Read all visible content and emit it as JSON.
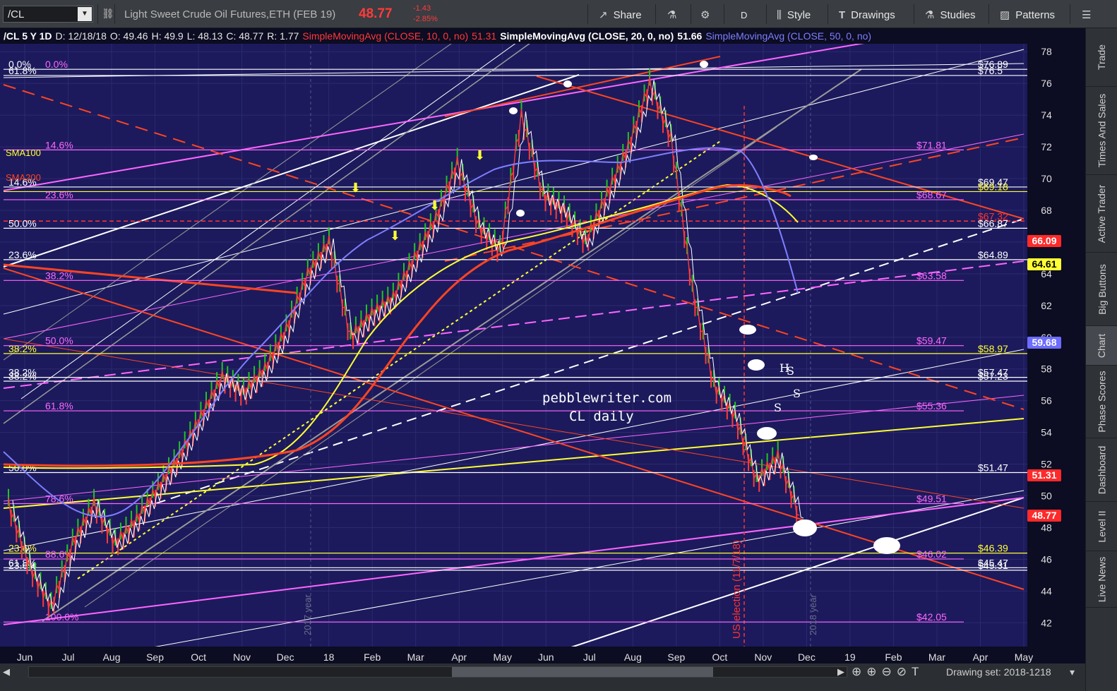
{
  "toolbar": {
    "symbol": "/CL",
    "instrument_title": "Light Sweet Crude Oil Futures,ETH (FEB 19)",
    "price": "48.77",
    "change": "-1.43",
    "change_pct": "-2.85%",
    "share_label": "Share",
    "aggregation_label": "D",
    "style_label": "Style",
    "drawings_label": "Drawings",
    "studies_label": "Studies",
    "patterns_label": "Patterns"
  },
  "chart_header": {
    "symbol_period": "/CL 5 Y 1D",
    "date": "D: 12/18/18",
    "open": "O: 49.46",
    "high": "H: 49.9",
    "low": "L: 48.13",
    "close": "C: 48.77",
    "range": "R: 1.77",
    "sma10_label": "SimpleMovingAvg (CLOSE, 10, 0, no)",
    "sma10_value": "51.31",
    "sma20_label": "SimpleMovingAvg (CLOSE, 20, 0, no)",
    "sma20_value": "51.66",
    "sma50_label": "SimpleMovingAvg (CLOSE, 50, 0, no)"
  },
  "right_tabs": [
    "Trade",
    "Times And Sales",
    "Active Trader",
    "Big Buttons",
    "Chart",
    "Phase Scores",
    "Dashboard",
    "Level II",
    "Live News"
  ],
  "active_tab": "Chart",
  "bottom_bar": {
    "drawing_set": "Drawing set: 2018-1218"
  },
  "watermark": {
    "line1": "pebblewriter.com",
    "line2": "CL daily"
  },
  "annotations": {
    "election": "US election (11/7/18)",
    "year_2017": "2017 year",
    "year_2018": "2018 year",
    "sma100": "SMA100",
    "sma200": "SMA200",
    "hs_h": "H",
    "hs_s": "S"
  },
  "chart_data": {
    "type": "candlestick",
    "symbol": "/CL",
    "x_labels": [
      "Jun",
      "Jul",
      "Aug",
      "Sep",
      "Oct",
      "Nov",
      "Dec",
      "18",
      "Feb",
      "Mar",
      "Apr",
      "May",
      "Jun",
      "Jul",
      "Aug",
      "Sep",
      "Oct",
      "Nov",
      "Dec",
      "19",
      "Feb",
      "Mar",
      "Apr",
      "May"
    ],
    "y_ticks": [
      42,
      44,
      46,
      48,
      50,
      52,
      54,
      56,
      58,
      60,
      62,
      64,
      66,
      68,
      70,
      72,
      74,
      76,
      78
    ],
    "ylim": [
      40.5,
      78.5
    ],
    "close_path": [
      [
        "Jun",
        49.5
      ],
      [
        "Jul",
        45.5
      ],
      [
        "Jul",
        43.0
      ],
      [
        "Aug",
        47.0
      ],
      [
        "Aug",
        49.5
      ],
      [
        "Sep",
        47.0
      ],
      [
        "Sep",
        48.5
      ],
      [
        "Oct",
        50.5
      ],
      [
        "Oct",
        52.5
      ],
      [
        "Nov",
        55.0
      ],
      [
        "Nov",
        57.5
      ],
      [
        "Dec",
        56.5
      ],
      [
        "Dec",
        58.0
      ],
      [
        "18",
        60.5
      ],
      [
        "18",
        64.0
      ],
      [
        "Feb",
        66.0
      ],
      [
        "Feb",
        60.0
      ],
      [
        "Mar",
        61.5
      ],
      [
        "Mar",
        62.5
      ],
      [
        "Apr",
        65.0
      ],
      [
        "Apr",
        67.5
      ],
      [
        "May",
        71.0
      ],
      [
        "May",
        67.0
      ],
      [
        "Jun",
        65.5
      ],
      [
        "Jul",
        74.0
      ],
      [
        "Jul",
        69.0
      ],
      [
        "Aug",
        68.0
      ],
      [
        "Aug",
        66.0
      ],
      [
        "Sep",
        69.0
      ],
      [
        "Sep",
        72.0
      ],
      [
        "Oct",
        76.0
      ],
      [
        "Oct",
        72.5
      ],
      [
        "Nov",
        63.0
      ],
      [
        "Nov",
        57.0
      ],
      [
        "Nov",
        55.0
      ],
      [
        "Dec",
        51.0
      ],
      [
        "Dec",
        52.5
      ],
      [
        "Dec",
        48.77
      ]
    ],
    "price_levels": [
      {
        "label": "76.89",
        "value": 76.89,
        "color": "#ffffff"
      },
      {
        "label": "76.5",
        "value": 76.5,
        "color": "#ffffff"
      },
      {
        "label": "71.81",
        "value": 71.81,
        "color": "#ff66ff"
      },
      {
        "label": "69.47",
        "value": 69.47,
        "color": "#ffffff"
      },
      {
        "label": "69.18",
        "value": 69.18,
        "color": "#ffff33"
      },
      {
        "label": "68.67",
        "value": 68.67,
        "color": "#ff66ff"
      },
      {
        "label": "67.32",
        "value": 67.32,
        "color": "#ff3333"
      },
      {
        "label": "66.87",
        "value": 66.87,
        "color": "#ffffff"
      },
      {
        "label": "64.89",
        "value": 64.89,
        "color": "#ffffff"
      },
      {
        "label": "63.58",
        "value": 63.58,
        "color": "#ff66ff"
      },
      {
        "label": "59.47",
        "value": 59.47,
        "color": "#ff66ff"
      },
      {
        "label": "58.97",
        "value": 58.97,
        "color": "#ffff33"
      },
      {
        "label": "57.47",
        "value": 57.47,
        "color": "#ffffff"
      },
      {
        "label": "57.23",
        "value": 57.23,
        "color": "#ffffff"
      },
      {
        "label": "55.36",
        "value": 55.36,
        "color": "#ff66ff"
      },
      {
        "label": "51.47",
        "value": 51.47,
        "color": "#ffffff"
      },
      {
        "label": "49.51",
        "value": 49.51,
        "color": "#ff66ff"
      },
      {
        "label": "46.39",
        "value": 46.39,
        "color": "#ffff33"
      },
      {
        "label": "46.02",
        "value": 46.02,
        "color": "#ff66ff"
      },
      {
        "label": "45.47",
        "value": 45.47,
        "color": "#ffffff"
      },
      {
        "label": "45.31",
        "value": 45.31,
        "color": "#ffffff"
      },
      {
        "label": "42.05",
        "value": 42.05,
        "color": "#ff66ff"
      }
    ],
    "fib_labels": [
      {
        "label": "0.0%",
        "value": 76.89,
        "color": "#ffffff"
      },
      {
        "label": "61.8%",
        "value": 76.5,
        "color": "#ffffff"
      },
      {
        "label": "0.0%",
        "value": 76.89,
        "color": "#ff66ff"
      },
      {
        "label": "14.6%",
        "value": 71.81,
        "color": "#ff66ff"
      },
      {
        "label": "14.6%",
        "value": 69.47,
        "color": "#ffffff"
      },
      {
        "label": "23.6%",
        "value": 68.67,
        "color": "#ff66ff"
      },
      {
        "label": "50.0%",
        "value": 66.87,
        "color": "#ffffff"
      },
      {
        "label": "23.6%",
        "value": 64.89,
        "color": "#ffffff"
      },
      {
        "label": "38.2%",
        "value": 63.58,
        "color": "#ff66ff"
      },
      {
        "label": "50.0%",
        "value": 59.47,
        "color": "#ff66ff"
      },
      {
        "label": "38.2%",
        "value": 58.97,
        "color": "#ffff33"
      },
      {
        "label": "38.2%",
        "value": 57.47,
        "color": "#ffffff"
      },
      {
        "label": "38.2%",
        "value": 57.23,
        "color": "#ffffff"
      },
      {
        "label": "61.8%",
        "value": 55.36,
        "color": "#ff66ff"
      },
      {
        "label": "50.0%",
        "value": 51.47,
        "color": "#ffffff"
      },
      {
        "label": "78.6%",
        "value": 49.51,
        "color": "#ff66ff"
      },
      {
        "label": "23.6%",
        "value": 46.39,
        "color": "#ffff33"
      },
      {
        "label": "88.6%",
        "value": 46.02,
        "color": "#ff66ff"
      },
      {
        "label": "61.8%",
        "value": 45.47,
        "color": "#ffffff"
      },
      {
        "label": "23.6%",
        "value": 45.31,
        "color": "#ffffff"
      },
      {
        "label": "100.0%",
        "value": 42.05,
        "color": "#ff66ff"
      }
    ],
    "price_tags": [
      {
        "label": "66.09",
        "value": 66.09,
        "bg": "#ff2a2a",
        "fg": "#ffffff"
      },
      {
        "label": "64.61",
        "value": 64.61,
        "bg": "#ffff33",
        "fg": "#000000"
      },
      {
        "label": "59.68",
        "value": 59.68,
        "bg": "#6d6dff",
        "fg": "#ffffff"
      },
      {
        "label": "51.31",
        "value": 51.31,
        "bg": "#ff2a2a",
        "fg": "#ffffff"
      },
      {
        "label": "48.77",
        "value": 48.77,
        "bg": "#ff2a2a",
        "fg": "#ffffff"
      }
    ],
    "colors": {
      "background": "#1c1a5c",
      "sma10": "#ff3a3a",
      "sma20": "#ffffff",
      "sma50": "#7e7eff",
      "sma100": "#ffff33",
      "sma200": "#ff4422",
      "fib_pink": "#ff66ff",
      "grid": "#2c2a70"
    }
  }
}
